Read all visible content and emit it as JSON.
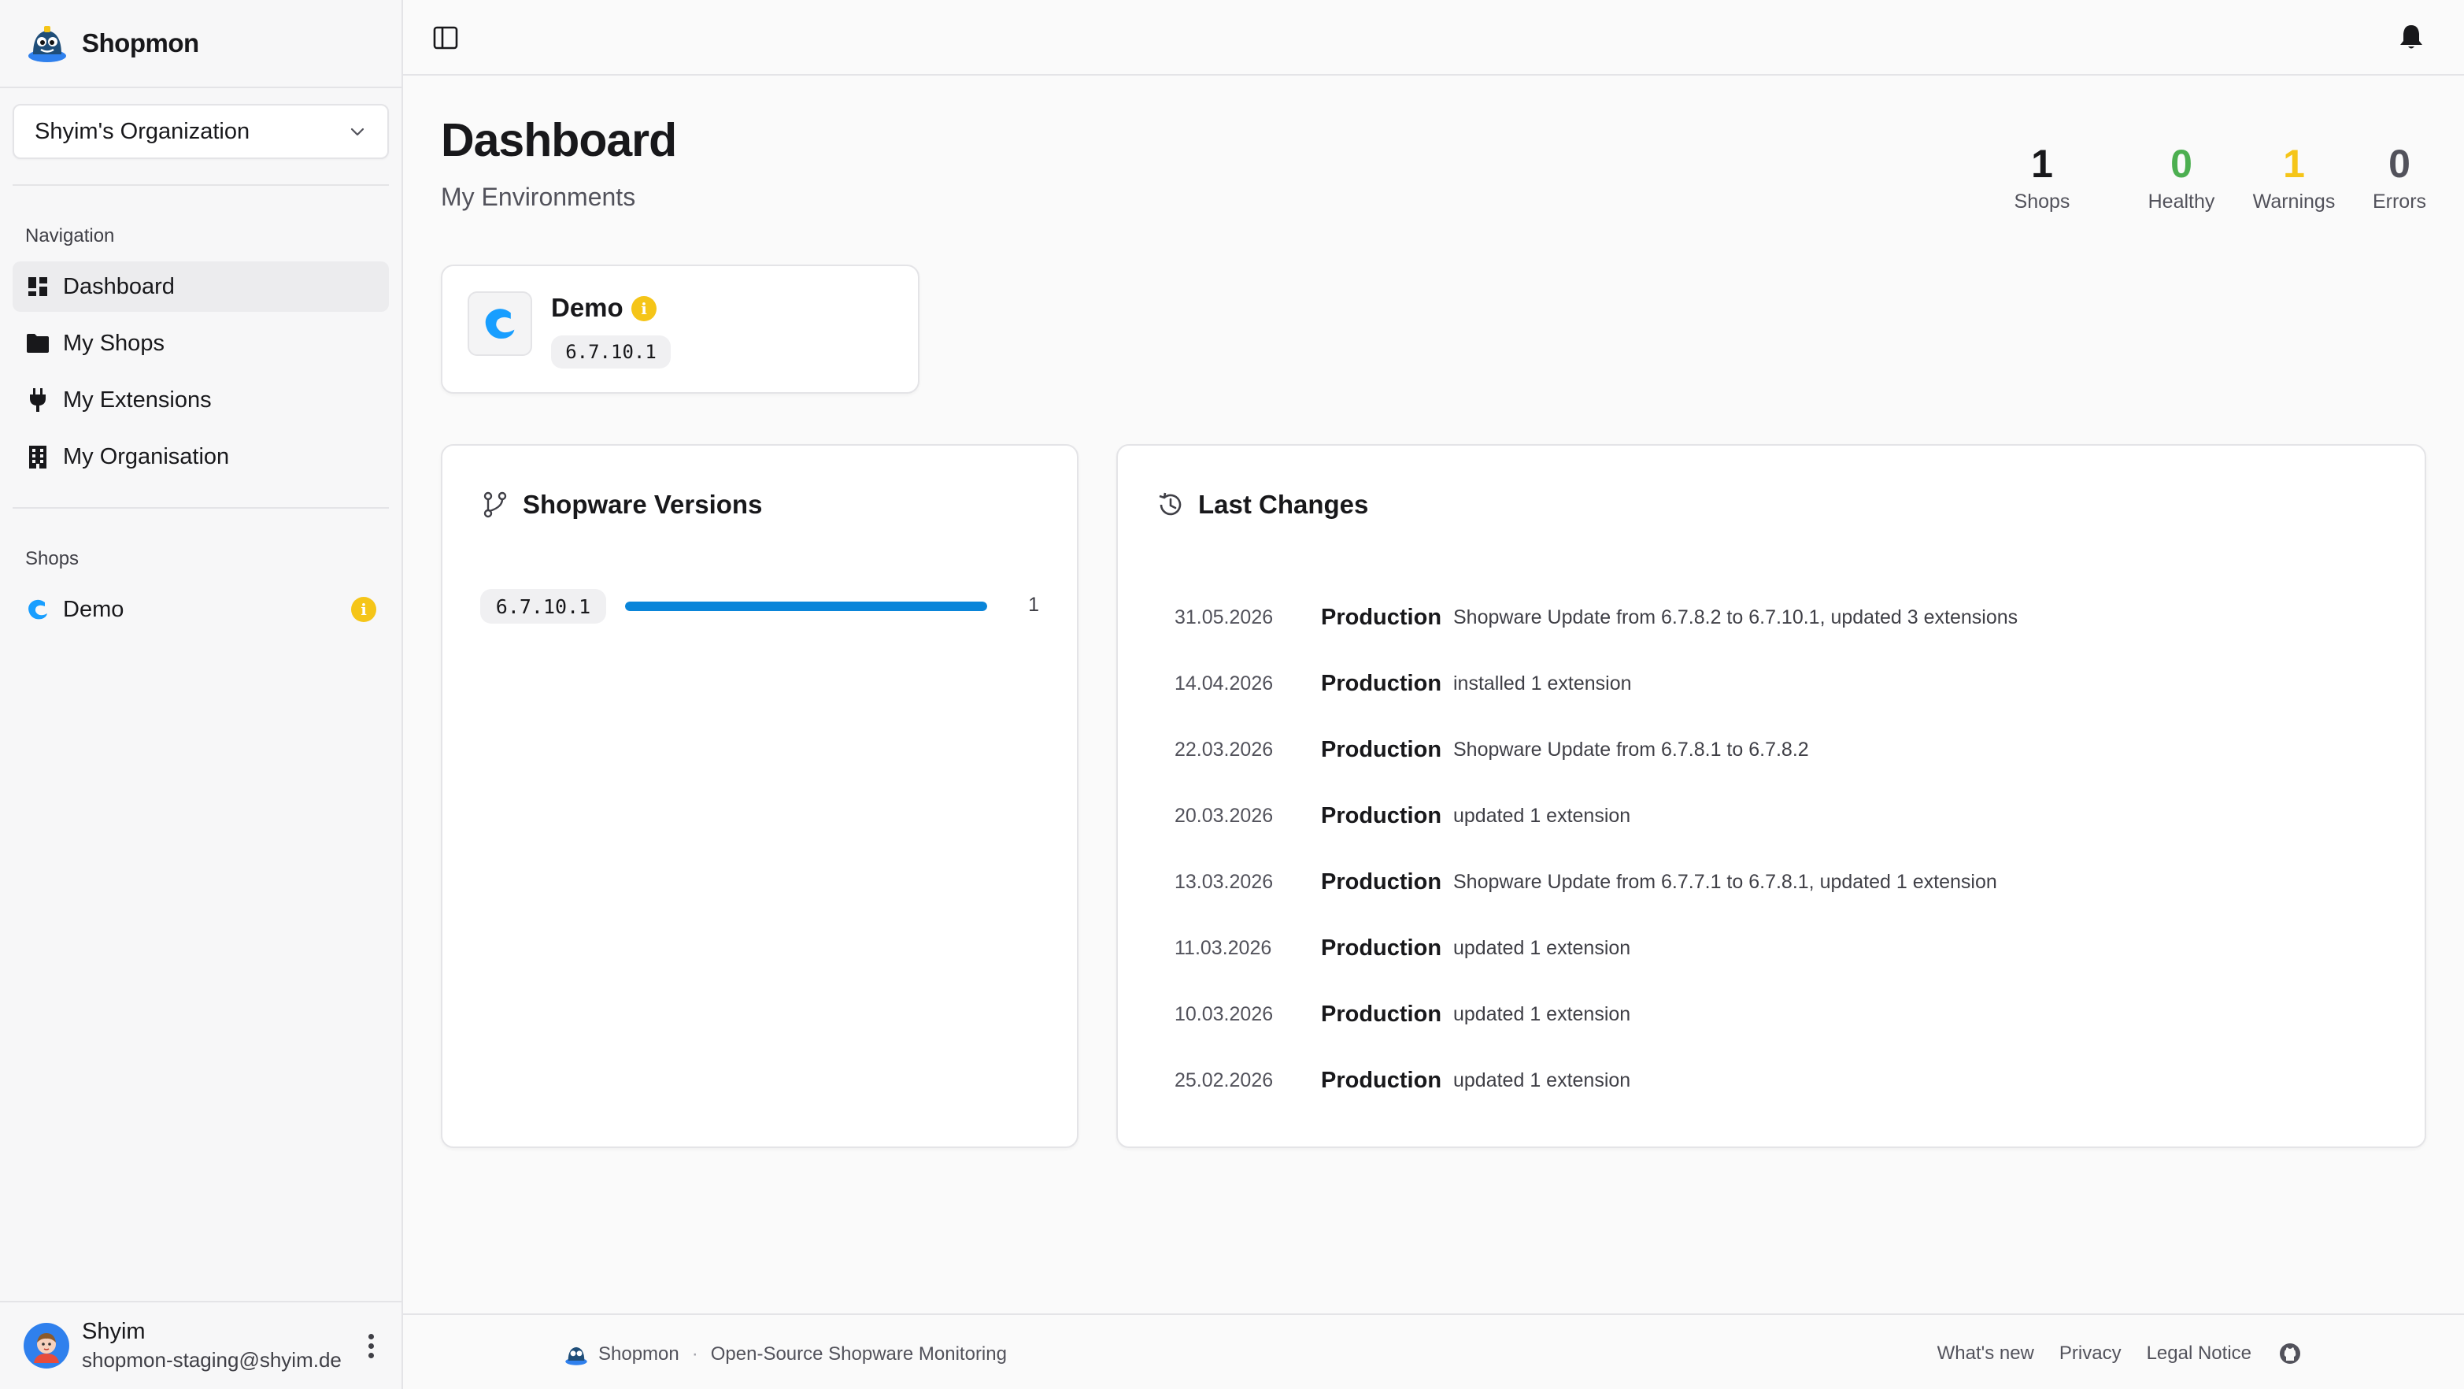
{
  "app": {
    "name": "Shopmon"
  },
  "org_select": {
    "value": "Shyim's Organization"
  },
  "sidebar": {
    "nav_heading": "Navigation",
    "nav_items": [
      {
        "label": "Dashboard",
        "icon": "dashboard-icon",
        "active": true
      },
      {
        "label": "My Shops",
        "icon": "folder-icon"
      },
      {
        "label": "My Extensions",
        "icon": "plug-icon"
      },
      {
        "label": "My Organisation",
        "icon": "building-icon"
      }
    ],
    "shops_heading": "Shops",
    "shops": [
      {
        "label": "Demo",
        "status": "info"
      }
    ]
  },
  "user": {
    "name": "Shyim",
    "email": "shopmon-staging@shyim.de"
  },
  "page": {
    "title": "Dashboard",
    "subtitle": "My Environments"
  },
  "stats": [
    {
      "value": "1",
      "label": "Shops",
      "color": "#18181b"
    },
    {
      "value": "0",
      "label": "Healthy",
      "color": "#4caf50"
    },
    {
      "value": "1",
      "label": "Warnings",
      "color": "#f5c518"
    },
    {
      "value": "0",
      "label": "Errors",
      "color": "#52525b"
    }
  ],
  "shop_card": {
    "name": "Demo",
    "version": "6.7.10.1",
    "status": "info"
  },
  "versions": {
    "title": "Shopware Versions",
    "items": [
      {
        "version": "6.7.10.1",
        "count": "1",
        "fraction": 1.0
      }
    ]
  },
  "changes": {
    "title": "Last Changes",
    "rows": [
      {
        "date": "31.05.2026",
        "env": "Production",
        "desc": "Shopware Update from 6.7.8.2 to 6.7.10.1, updated 3 extensions"
      },
      {
        "date": "14.04.2026",
        "env": "Production",
        "desc": "installed 1 extension"
      },
      {
        "date": "22.03.2026",
        "env": "Production",
        "desc": "Shopware Update from 6.7.8.1 to 6.7.8.2"
      },
      {
        "date": "20.03.2026",
        "env": "Production",
        "desc": "updated 1 extension"
      },
      {
        "date": "13.03.2026",
        "env": "Production",
        "desc": "Shopware Update from 6.7.7.1 to 6.7.8.1, updated 1 extension"
      },
      {
        "date": "11.03.2026",
        "env": "Production",
        "desc": "updated 1 extension"
      },
      {
        "date": "10.03.2026",
        "env": "Production",
        "desc": "updated 1 extension"
      },
      {
        "date": "25.02.2026",
        "env": "Production",
        "desc": "updated 1 extension"
      }
    ]
  },
  "footer": {
    "brand": "Shopmon",
    "separator": "·",
    "tagline": "Open-Source Shopware Monitoring",
    "links": [
      "What's new",
      "Privacy",
      "Legal Notice"
    ]
  }
}
